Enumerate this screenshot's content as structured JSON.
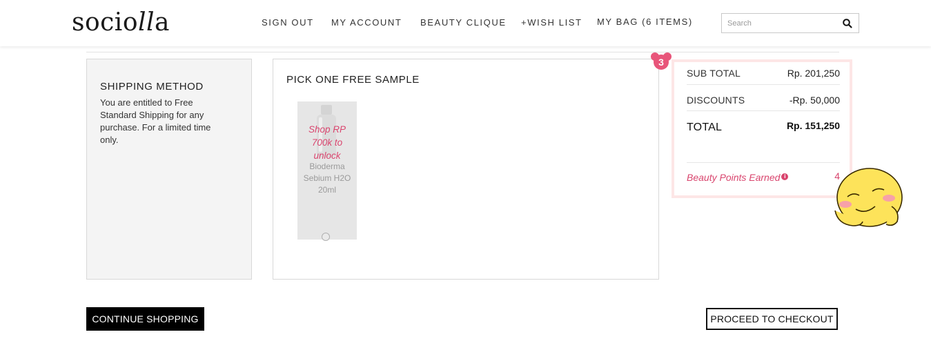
{
  "brand": {
    "logo_main": "socio",
    "logo_italic": "ll",
    "logo_end": "a"
  },
  "nav": [
    {
      "label": "SIGN OUT"
    },
    {
      "label": "MY ACCOUNT"
    },
    {
      "label": "BEAUTY CLIQUE"
    },
    {
      "label": "+WISH LIST"
    },
    {
      "label": "MY BAG (6 ITEMS)"
    }
  ],
  "search": {
    "placeholder": "Search",
    "icon": "search-icon"
  },
  "shipping": {
    "title": "SHIPPING METHOD",
    "text": "You are entitled to Free Standard Shipping for any purchase. For a limited time only."
  },
  "samples": {
    "title": "PICK ONE FREE SAMPLE",
    "items": [
      {
        "lock_text": "Shop RP 700k to unlock",
        "name": "Bioderma Sebium H2O 20ml"
      }
    ]
  },
  "badge": {
    "number": "3"
  },
  "summary": {
    "subtotal_label": "SUB TOTAL",
    "subtotal_value": "Rp. 201,250",
    "discount_label": "DISCOUNTS",
    "discount_value": "-Rp. 50,000",
    "total_label": "TOTAL",
    "total_value": "Rp. 151,250",
    "points_label": "Beauty Points Earned",
    "points_info": "i",
    "points_value": "4"
  },
  "buttons": {
    "continue": "CONTINUE SHOPPING",
    "checkout": "PROCEED TO CHECKOUT"
  },
  "colors": {
    "accent_pink": "#d9456e",
    "summary_border": "#fde6e6",
    "primary_button": "#000000"
  }
}
